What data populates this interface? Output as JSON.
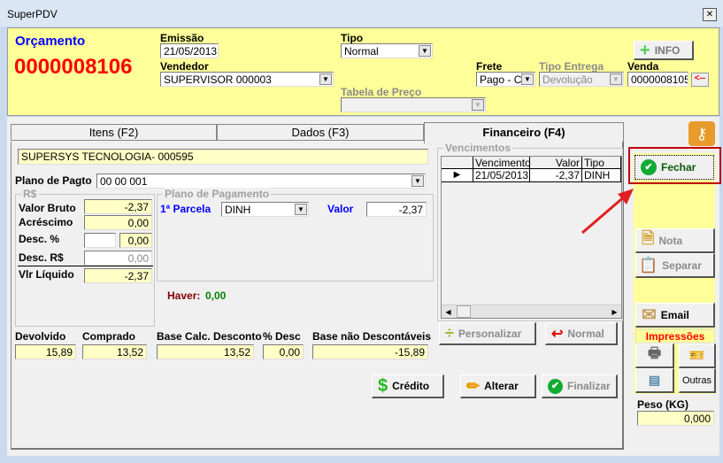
{
  "window": {
    "title": "SuperPDV",
    "close": "✕"
  },
  "header": {
    "doc_type": "Orçamento",
    "doc_number": "0000008106",
    "emissao_label": "Emissão",
    "emissao": "21/05/2013",
    "tipo_label": "Tipo",
    "tipo": "Normal",
    "vendedor_label": "Vendedor",
    "vendedor": "SUPERVISOR   000003",
    "tabela_label": "Tabela de Preço",
    "tabela": "",
    "frete_label": "Frete",
    "frete": "Pago - CII",
    "tipo_entrega_label": "Tipo Entrega",
    "tipo_entrega": "Devolução",
    "venda_label": "Venda",
    "venda": "0000008105",
    "venda_back": "<--",
    "info_button": "INFO"
  },
  "tabs": [
    {
      "label": "Itens (F2)"
    },
    {
      "label": "Dados (F3)"
    },
    {
      "label": "Financeiro (F4)",
      "active": true
    }
  ],
  "financeiro": {
    "cliente": "SUPERSYS TECNOLOGIA- 000595",
    "plano_label": "Plano de Pagto",
    "plano": "00   00   001",
    "rs_group": "R$",
    "valor_bruto_label": "Valor Bruto",
    "valor_bruto": "-2,37",
    "acrescimo_label": "Acréscimo",
    "acrescimo": "0,00",
    "desc_pct_label": "Desc. %",
    "desc_pct": "",
    "desc_pct_val": "0,00",
    "desc_rs_label": "Desc. R$",
    "desc_rs": "0,00",
    "liquido_label": "Vlr Líquido",
    "liquido": "-2,37",
    "plano_group": "Plano de Pagamento",
    "parcela_label": "1ª Parcela",
    "parcela": "DINH",
    "valor_label": "Valor",
    "valor": "-2,37",
    "haver_label": "Haver:",
    "haver": "0,00",
    "devolvido_label": "Devolvido",
    "devolvido": "15,89",
    "comprado_label": "Comprado",
    "comprado": "13,52",
    "base_calc_label": "Base Calc. Desconto",
    "base_calc": "13,52",
    "pct_desc_label": "% Desc",
    "pct_desc": "0,00",
    "base_nao_label": "Base não Descontáveis",
    "base_nao": "-15,89",
    "venc_group": "Vencimentos",
    "venc_columns": [
      "Vencimento",
      "Valor",
      "Tipo"
    ],
    "venc_rows": [
      {
        "vencimento": "21/05/2013",
        "valor": "-2,37",
        "tipo": "DINH"
      }
    ],
    "personalizar": "Personalizar",
    "normal": "Normal",
    "credito": "Crédito",
    "alterar": "Alterar",
    "finalizar": "Finalizar"
  },
  "side": {
    "fechar": "Fechar",
    "nota": "Nota",
    "separar": "Separar",
    "email": "Email",
    "impressoes": "Impressões",
    "outras": "Outras",
    "peso_label": "Peso (KG)",
    "peso": "0,000"
  },
  "colors": {
    "accent_red": "#ff0000",
    "title_blue": "#0000ff",
    "panel_yellow": "#ffff99",
    "highlight": "#c00000"
  }
}
